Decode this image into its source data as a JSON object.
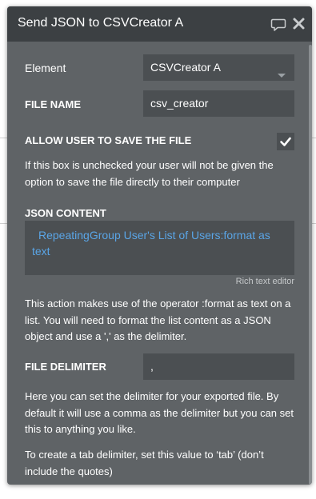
{
  "window": {
    "title": "Send JSON to CSVCreator A",
    "comment_icon": "speech-bubble-icon",
    "close_icon": "close-x-icon"
  },
  "fields": {
    "element": {
      "label": "Element",
      "value": "CSVCreator A"
    },
    "file_name": {
      "label": "FILE NAME",
      "value": "csv_creator"
    },
    "allow_save": {
      "label": "ALLOW USER TO SAVE THE FILE",
      "checked": true,
      "help": "If this box is unchecked your user will not be given the option to save the file directly to their computer"
    },
    "json_content": {
      "label": "JSON CONTENT",
      "value": "RepeatingGroup User's List of Users:format as text",
      "editor_caption": "Rich text editor",
      "help": "This action makes use of the operator :format as text on a list. You will need to format the list content as a JSON object and use a ',' as the delimiter."
    },
    "file_delimiter": {
      "label": "FILE DELIMITER",
      "value": ",",
      "help_1": "Here you can set the delimiter for your exported file. By default it will use a comma as the delimiter but you can set this to anything you like.",
      "help_2": "To create a tab delimiter, set this value to ‘tab’ (don’t include the quotes)"
    }
  },
  "colors": {
    "panel": "#5f6366",
    "header": "#3c4043",
    "input": "#4b4f52",
    "dynamic_text": "#5aa5e6"
  }
}
